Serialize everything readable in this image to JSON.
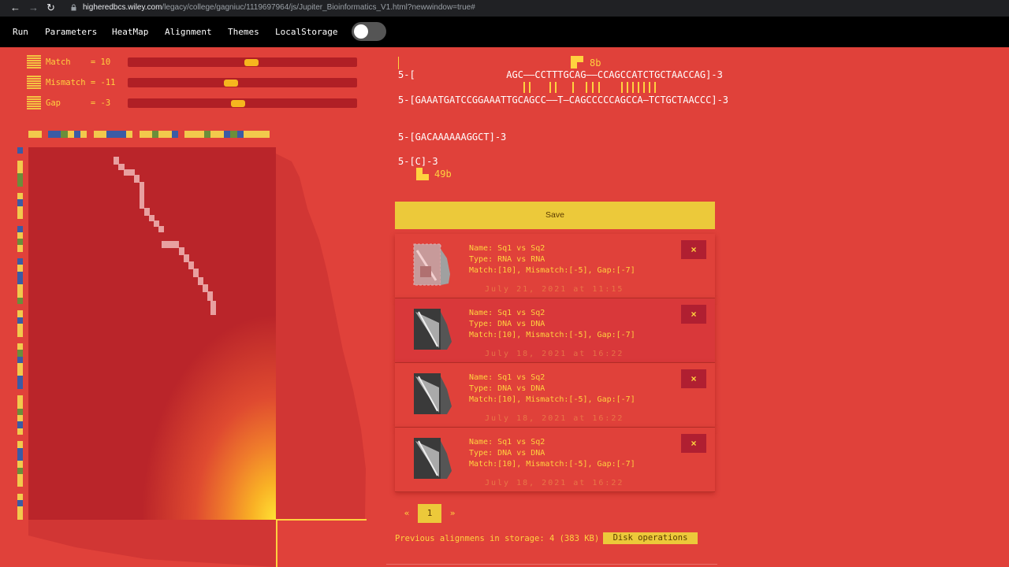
{
  "browser": {
    "url_host": "higheredbcs.wiley.com",
    "url_path": "/legacy/college/gagniuc/1119697964/js/Jupiter_Bioinformatics_V1.html?newwindow=true#"
  },
  "menu": {
    "items": [
      "Run",
      "Parameters",
      "HeatMap",
      "Alignment",
      "Themes",
      "LocalStorage"
    ]
  },
  "parameters": [
    {
      "label": "Match    = 10",
      "value": 10,
      "level": 0.54
    },
    {
      "label": "Mismatch = -11",
      "value": -11,
      "level": 0.45
    },
    {
      "label": "Gap      = -3",
      "value": -3,
      "level": 0.48
    }
  ],
  "heatmap": {
    "top_colors": [
      "#f2c94c",
      "#f2c94c",
      "#e0413a",
      "#3b5ba5",
      "#3b5ba5",
      "#6b8e3a",
      "#f2c94c",
      "#3b5ba5",
      "#f2c94c",
      "#e0413a",
      "#f2c94c",
      "#f2c94c",
      "#3b5ba5",
      "#3b5ba5",
      "#3b5ba5",
      "#f2c94c",
      "#e0413a",
      "#f2c94c",
      "#f2c94c",
      "#6b8e3a",
      "#f2c94c",
      "#f2c94c",
      "#3b5ba5",
      "#e0413a",
      "#f2c94c",
      "#f2c94c",
      "#f2c94c",
      "#6b8e3a",
      "#f2c94c",
      "#f2c94c",
      "#3b5ba5",
      "#6b8e3a",
      "#3b5ba5",
      "#f2c94c",
      "#f2c94c",
      "#f2c94c",
      "#f2c94c",
      "#e0413a"
    ],
    "left_colors": [
      "#3b5ba5",
      "#e0413a",
      "#f2c94c",
      "#f2c94c",
      "#6b8e3a",
      "#6b8e3a",
      "#e0413a",
      "#f2c94c",
      "#3b5ba5",
      "#f2c94c",
      "#f2c94c",
      "#e0413a",
      "#3b5ba5",
      "#f2c94c",
      "#6b8e3a",
      "#f2c94c",
      "#e0413a",
      "#3b5ba5",
      "#f2c94c",
      "#3b5ba5",
      "#3b5ba5",
      "#f2c94c",
      "#f2c94c",
      "#6b8e3a",
      "#e0413a",
      "#f2c94c",
      "#3b5ba5",
      "#f2c94c",
      "#f2c94c",
      "#e0413a",
      "#f2c94c",
      "#6b8e3a",
      "#3b5ba5",
      "#f2c94c",
      "#f2c94c",
      "#3b5ba5",
      "#3b5ba5",
      "#e0413a",
      "#f2c94c",
      "#f2c94c",
      "#6b8e3a",
      "#f2c94c",
      "#3b5ba5",
      "#f2c94c",
      "#e0413a",
      "#f2c94c",
      "#3b5ba5",
      "#3b5ba5",
      "#f2c94c",
      "#6b8e3a",
      "#f2c94c",
      "#f2c94c",
      "#e0413a",
      "#f2c94c",
      "#3b5ba5",
      "#f2c94c",
      "#f2c94c"
    ]
  },
  "alignment": {
    "marker_top": "8b",
    "seq1": "5-[                AGC——CCTTTGCAG——CCAGCCATCTGCTAACCAG]-3",
    "seq2": "5-[GAAATGATCCGGAAATTGCAGCC——T—CAGCCCCCAGCCA—TCTGCTAACCC]-3",
    "seq3": "5-[GACAAAAAAGGCT]-3",
    "seq4": "5-[C]-3",
    "marker_bottom": "49b"
  },
  "save_label": "Save",
  "saved_items": [
    {
      "name": "Name: Sq1 vs Sq2",
      "type": "Type: RNA vs RNA",
      "params": "Match:[10], Mismatch:[-5], Gap:[-7]",
      "date": "July 21, 2021 at 11:15",
      "close": "×"
    },
    {
      "name": "Name: Sq1 vs Sq2",
      "type": "Type: DNA vs DNA",
      "params": "Match:[10], Mismatch:[-5], Gap:[-7]",
      "date": "July 18, 2021 at 16:22",
      "close": "×"
    },
    {
      "name": "Name: Sq1 vs Sq2",
      "type": "Type: DNA vs DNA",
      "params": "Match:[10], Mismatch:[-5], Gap:[-7]",
      "date": "July 18, 2021 at 16:22",
      "close": "×"
    },
    {
      "name": "Name: Sq1 vs Sq2",
      "type": "Type: DNA vs DNA",
      "params": "Match:[10], Mismatch:[-5], Gap:[-7]",
      "date": "July 18, 2021 at 16:22",
      "close": "×"
    }
  ],
  "pagination": {
    "prev": "«",
    "current": "1",
    "next": "»"
  },
  "storage": {
    "text": "Previous alignmens in storage: 4 (383 KB)",
    "button": "Disk operations"
  }
}
